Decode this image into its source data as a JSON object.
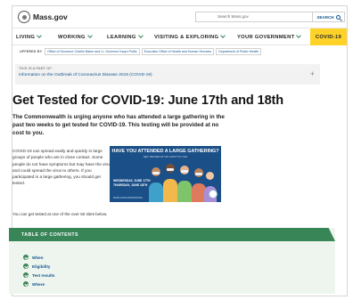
{
  "header": {
    "logo_text": "Mass.gov",
    "search_placeholder": "Search Mass.gov",
    "search_button_label": "SEARCH"
  },
  "nav": {
    "items": [
      {
        "label": "LIVING"
      },
      {
        "label": "WORKING"
      },
      {
        "label": "LEARNING"
      },
      {
        "label": "VISITING & EXPLORING"
      },
      {
        "label": "YOUR GOVERNMENT"
      }
    ],
    "covid_label": "COVID-19"
  },
  "offered_by": {
    "label": "OFFERED BY",
    "links": [
      "Office of Governor Charlie Baker and Lt. Governor Karyn Polito",
      "Executive Office of Health and Human Services",
      "Department of Public Health"
    ]
  },
  "part_of": {
    "label": "THIS IS A PART OF:",
    "link": "Information on the Outbreak of Coronavirus Disease 2019 (COVID-19)"
  },
  "page": {
    "title": "Get Tested for COVID-19: June 17th and 18th",
    "lead": "The Commonwealth is urging anyone who has attended a large gathering in the past two weeks to get tested for COVID-19. This testing will be provided at no cost to you.",
    "body": "COVID-19 can spread easily and quickly in large groups of people who are in close contact. Some people do not have symptoms but may have the virus and could spread the virus to others. If you participated in a large gathering, you should get tested.",
    "test_sites": "You can get tested at one of the over 50 sites below."
  },
  "promo": {
    "title": "HAVE YOU ATTENDED A LARGE GATHERING?",
    "subtitle": "GET TESTED AT NO COST TO YOU",
    "date_line1": "WEDNESDAY, JUNE 17TH",
    "date_line2": "THURSDAY, JUNE 18TH",
    "footer": "MASS.GOV/COVIDTESTING",
    "colors": {
      "background": "#1a4f88",
      "figures": [
        "#3fa0c9",
        "#f2b84b",
        "#7fc36b",
        "#e07a5f",
        "#a88fd8"
      ]
    }
  },
  "toc": {
    "title": "TABLE OF CONTENTS",
    "items": [
      {
        "label": "When"
      },
      {
        "label": "Eligibility"
      },
      {
        "label": "Test results"
      },
      {
        "label": "Where"
      }
    ]
  },
  "colors": {
    "accent_green": "#388557",
    "link_blue": "#14558f",
    "covid_yellow": "#ffd22a"
  }
}
